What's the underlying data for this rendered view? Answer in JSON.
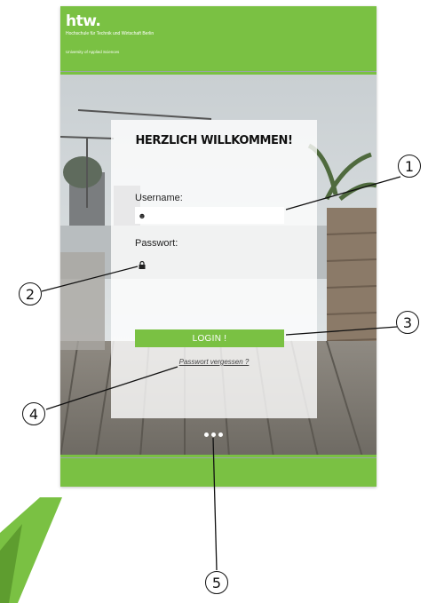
{
  "logo": {
    "text": "htw.",
    "subtitle": "Hochschule für Technik und Wirtschaft Berlin",
    "tagline": "University of Applied Sciences"
  },
  "login": {
    "title": "HERZLICH WILLKOMMEN!",
    "username_label": "Username:",
    "password_label": "Passwort:",
    "username_value": "",
    "password_value": "",
    "button_label": "LOGIN !",
    "forgot_link": "Passwort vergessen ?"
  },
  "callouts": [
    "1",
    "2",
    "3",
    "4",
    "5"
  ],
  "colors": {
    "brand_green": "#7ac143"
  }
}
